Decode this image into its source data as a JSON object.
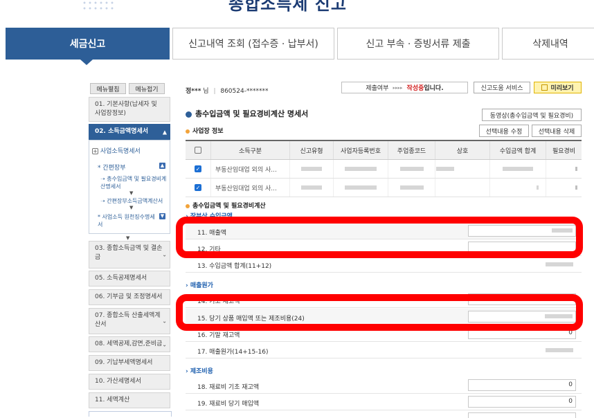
{
  "header": {
    "title": "종합소득세 신고"
  },
  "tabs": [
    {
      "label": "세금신고",
      "active": true
    },
    {
      "label": "신고내역 조회 (접수증 · 납부서)"
    },
    {
      "label": "신고 부속 · 증빙서류 제출"
    },
    {
      "label": "삭제내역"
    }
  ],
  "sidebar": {
    "edit_label": "메뉴펼침",
    "collapse_label": "메뉴접기",
    "items": [
      {
        "label": "01. 기본사항(납세자 및 사업장정보)"
      },
      {
        "label": "02. 소득금액명세서",
        "active": true
      },
      {
        "label": "03. 종합소득금액 및 결손금"
      },
      {
        "label": "05. 소득공제명세서"
      },
      {
        "label": "06. 기부금 및 조정명세서"
      },
      {
        "label": "07. 종합소득 산출세액계산서"
      },
      {
        "label": "08. 세액공제,감면,준비금"
      },
      {
        "label": "09. 기납부세액명세서"
      },
      {
        "label": "10. 가산세명세서"
      },
      {
        "label": "11. 세액계산"
      }
    ],
    "submenu": {
      "title": "사업소득명세서",
      "group": "간편장부",
      "sub1": "총수입금액 및 필요경비계산명세서",
      "sub2": "간편장부소득금액계산서",
      "group2": "사업소득 원천징수명세서"
    }
  },
  "user": {
    "name": "정***",
    "suffix": "님",
    "sep": "|",
    "id": "860524-*******"
  },
  "status": {
    "label": "제출여부",
    "arrows": "▸▸▸▸",
    "state_red": "작성중",
    "state_tail": "입니다."
  },
  "buttons": {
    "help": "신고도움 서비스",
    "preview": "미리보기",
    "video": "동영상(총수입금액 및 필요경비)",
    "edit_selected": "선택내용 수정",
    "delete_selected": "선택내용 삭제"
  },
  "main": {
    "title": "총수입금액 및 필요경비계산 명세서",
    "business_section": "사업장 정보",
    "calc_section": "총수입금액 및 필요경비계산",
    "sub_income": "장부상 수입금액",
    "sub_cost": "매출원가",
    "sub_mfg": "제조비용"
  },
  "table": {
    "headers": [
      "",
      "소득구분",
      "신고유형",
      "사업자등록번호",
      "주업종코드",
      "상호",
      "수입금액 합계",
      "필요경비"
    ],
    "rows": [
      {
        "type": "부동산임대업 외의 사..."
      },
      {
        "type": "부동산임대업 외의 사..."
      }
    ]
  },
  "calc_rows": [
    {
      "label": "11. 매출액"
    },
    {
      "label": "12. 기타"
    },
    {
      "label": "13. 수입금액 합계(11+12)"
    },
    {
      "label": "14. 기초 재고액"
    },
    {
      "label": "15. 당기 상품 매입액 또는 제조비용(24)"
    },
    {
      "label": "16. 기말 재고액",
      "value": "0"
    },
    {
      "label": "17. 매출원가(14+15-16)"
    },
    {
      "label": "18. 재료비 기초 재고액",
      "value": "0"
    },
    {
      "label": "19. 재료비 당기 매입액",
      "value": "0"
    }
  ]
}
